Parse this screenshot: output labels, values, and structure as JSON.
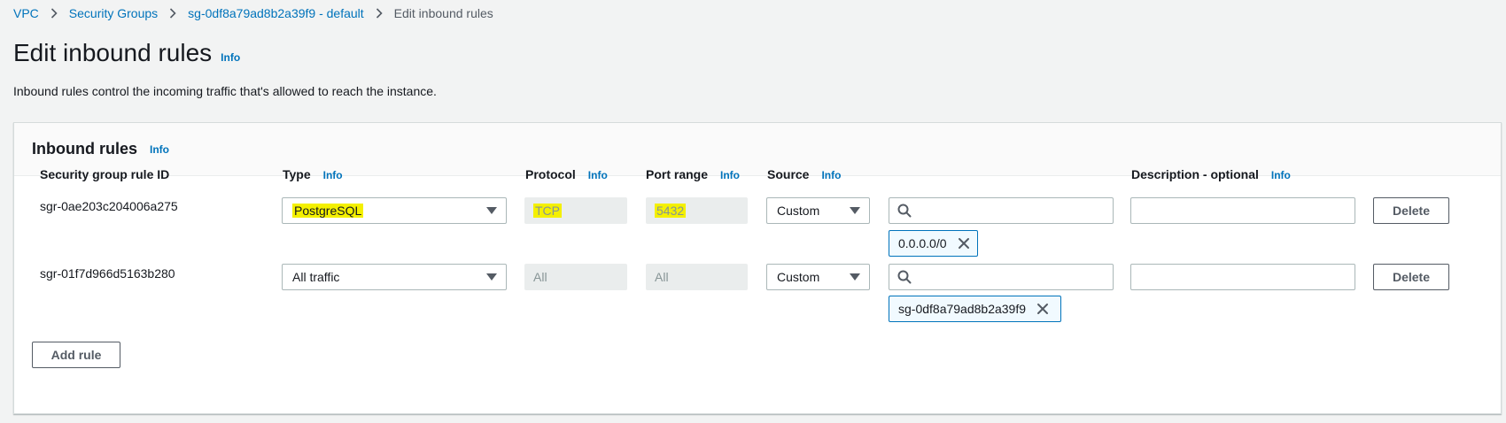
{
  "breadcrumb": {
    "items": [
      "VPC",
      "Security Groups",
      "sg-0df8a79ad8b2a39f9 - default"
    ],
    "current": "Edit inbound rules"
  },
  "page": {
    "title": "Edit inbound rules",
    "info": "Info",
    "description": "Inbound rules control the incoming traffic that's allowed to reach the instance."
  },
  "panel": {
    "title": "Inbound rules",
    "info": "Info",
    "columns": {
      "rule_id": "Security group rule ID",
      "type": "Type",
      "protocol": "Protocol",
      "port_range": "Port range",
      "source": "Source",
      "description": "Description - optional",
      "info": "Info"
    },
    "rows": [
      {
        "rule_id": "sgr-0ae203c204006a275",
        "type": "PostgreSQL",
        "protocol": "TCP",
        "port_range": "5432",
        "source_type": "Custom",
        "source_token": "0.0.0.0/0",
        "search_value": "",
        "description_value": "",
        "delete_label": "Delete"
      },
      {
        "rule_id": "sgr-01f7d966d5163b280",
        "type": "All traffic",
        "protocol": "All",
        "port_range": "All",
        "source_type": "Custom",
        "source_token": "sg-0df8a79ad8b2a39f9",
        "search_value": "",
        "description_value": "",
        "delete_label": "Delete"
      }
    ],
    "add_rule_label": "Add rule"
  },
  "colors": {
    "link": "#0073bb",
    "highlight": "#f4f000",
    "background": "#f2f3f3"
  }
}
